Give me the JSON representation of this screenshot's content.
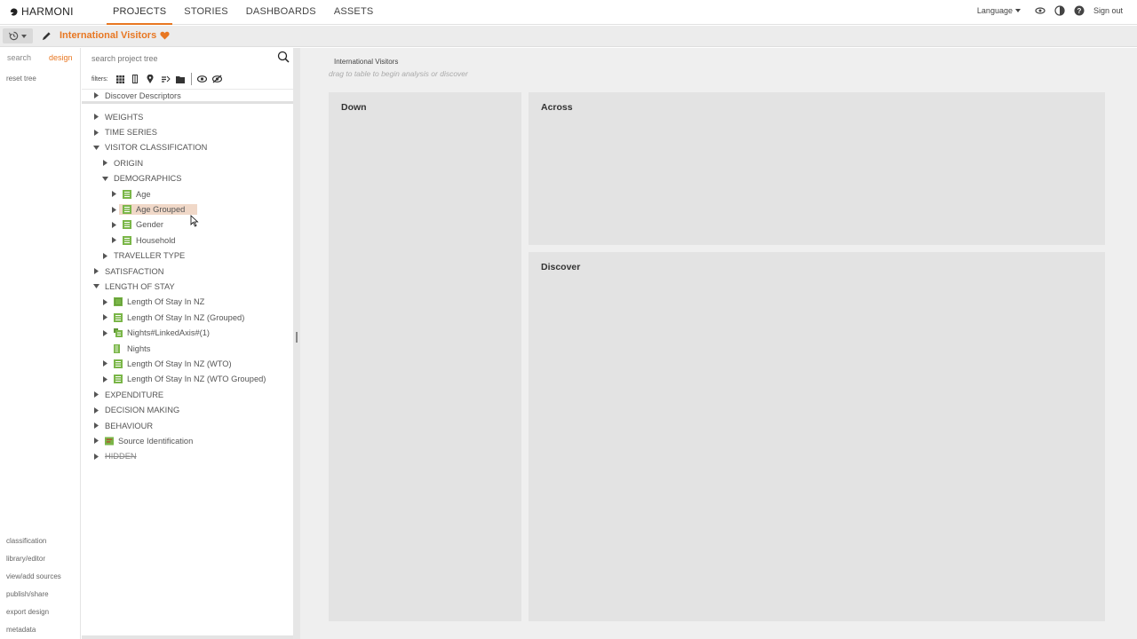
{
  "app": {
    "name": "HARMONI"
  },
  "nav": {
    "items": [
      "PROJECTS",
      "STORIES",
      "DASHBOARDS",
      "ASSETS"
    ],
    "active": "PROJECTS"
  },
  "topright": {
    "language": "Language",
    "signout": "Sign out"
  },
  "project": {
    "title": "International Visitors"
  },
  "rail": {
    "tabs": [
      "search",
      "design"
    ],
    "active_tab": "design",
    "reset": "reset tree",
    "links": [
      "classification",
      "library/editor",
      "view/add sources",
      "publish/share",
      "export design",
      "metadata"
    ]
  },
  "tree_panel": {
    "search_placeholder": "search project tree",
    "filters_label": "filters:",
    "descriptor_row": "Discover Descriptors"
  },
  "tree": [
    {
      "label": "WEIGHTS",
      "level": 0,
      "caret": "right"
    },
    {
      "label": "TIME SERIES",
      "level": 0,
      "caret": "right"
    },
    {
      "label": "VISITOR CLASSIFICATION",
      "level": 0,
      "caret": "down"
    },
    {
      "label": "ORIGIN",
      "level": 1,
      "caret": "right"
    },
    {
      "label": "DEMOGRAPHICS",
      "level": 1,
      "caret": "down"
    },
    {
      "label": "Age",
      "level": 2,
      "caret": "right",
      "icon": "list"
    },
    {
      "label": "Age Grouped",
      "level": 2,
      "caret": "right",
      "icon": "list",
      "highlight": true
    },
    {
      "label": "Gender",
      "level": 2,
      "caret": "right",
      "icon": "list"
    },
    {
      "label": "Household",
      "level": 2,
      "caret": "right",
      "icon": "list"
    },
    {
      "label": "TRAVELLER TYPE",
      "level": 1,
      "caret": "right"
    },
    {
      "label": "SATISFACTION",
      "level": 0,
      "caret": "right"
    },
    {
      "label": "LENGTH OF STAY",
      "level": 0,
      "caret": "down"
    },
    {
      "label": "Length Of Stay In NZ",
      "level": 1,
      "caret": "right",
      "icon": "grid"
    },
    {
      "label": "Length Of Stay In NZ (Grouped)",
      "level": 1,
      "caret": "right",
      "icon": "list"
    },
    {
      "label": "Nights#LinkedAxis#(1)",
      "level": 1,
      "caret": "right",
      "icon": "linked"
    },
    {
      "label": "Nights",
      "level": 1,
      "caret": "none",
      "icon": "numeric"
    },
    {
      "label": "Length Of Stay In NZ (WTO)",
      "level": 1,
      "caret": "right",
      "icon": "list"
    },
    {
      "label": "Length Of Stay In NZ (WTO Grouped)",
      "level": 1,
      "caret": "right",
      "icon": "list"
    },
    {
      "label": "EXPENDITURE",
      "level": 0,
      "caret": "right"
    },
    {
      "label": "DECISION MAKING",
      "level": 0,
      "caret": "right"
    },
    {
      "label": "BEHAVIOUR",
      "level": 0,
      "caret": "right"
    },
    {
      "label": "Source Identification",
      "level": 0,
      "caret": "right",
      "icon": "source"
    },
    {
      "label": "HIDDEN",
      "level": 0,
      "caret": "right",
      "strike": true
    }
  ],
  "canvas": {
    "title": "International Visitors",
    "hint": "drag to table to begin analysis or discover",
    "down": "Down",
    "across": "Across",
    "discover": "Discover"
  },
  "colors": {
    "accent": "#e87722",
    "icon_green": "#7ab648",
    "highlight": "#f0d8c8"
  }
}
